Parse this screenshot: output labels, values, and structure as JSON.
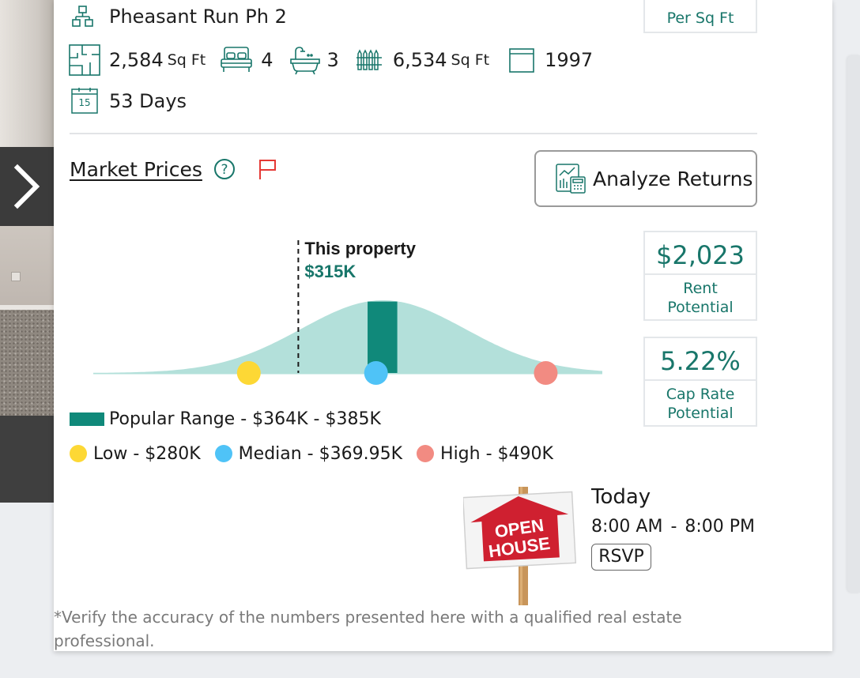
{
  "listing": {
    "subdivision": "Pheasant Run Ph 2",
    "living_area": "2,584",
    "living_area_unit": "Sq Ft",
    "bedrooms": "4",
    "bathrooms": "3",
    "lot_size": "6,534",
    "lot_size_unit": "Sq Ft",
    "year_built": "1997",
    "days_on_market": "53 Days",
    "calendar_icon_day": "15",
    "per_sq_ft_label": "Per Sq Ft"
  },
  "market": {
    "title": "Market Prices",
    "analyze_button": "Analyze Returns",
    "this_property_label": "This property",
    "this_property_value": "$315K",
    "legend": {
      "popular": "Popular Range - $364K - $385K",
      "low": "Low - $280K",
      "median": "Median - $369.95K",
      "high": "High - $490K"
    },
    "colors": {
      "curve": "#b3e0da",
      "popular": "#10897a",
      "low": "#fdd835",
      "median": "#4fc3f7",
      "high": "#f28b82",
      "accent": "#18766a",
      "flag": "#e53935"
    }
  },
  "chart_data": {
    "type": "area",
    "title": "",
    "values_k": {
      "low": 280,
      "median": 369.95,
      "high": 490,
      "popular_range": [
        364,
        385
      ],
      "this_property": 315
    }
  },
  "stats": {
    "rent_value": "$2,023",
    "rent_label_line1": "Rent",
    "rent_label_line2": "Potential",
    "cap_value": "5.22%",
    "cap_label_line1": "Cap Rate",
    "cap_label_line2": "Potential"
  },
  "open_house": {
    "sign_line1": "OPEN",
    "sign_line2": "HOUSE",
    "day": "Today",
    "start": "8:00 AM",
    "separator": "-",
    "end": "8:00 PM",
    "rsvp": "RSVP"
  },
  "disclaimer": "*Verify the accuracy of the numbers presented here with a qualified real estate professional."
}
